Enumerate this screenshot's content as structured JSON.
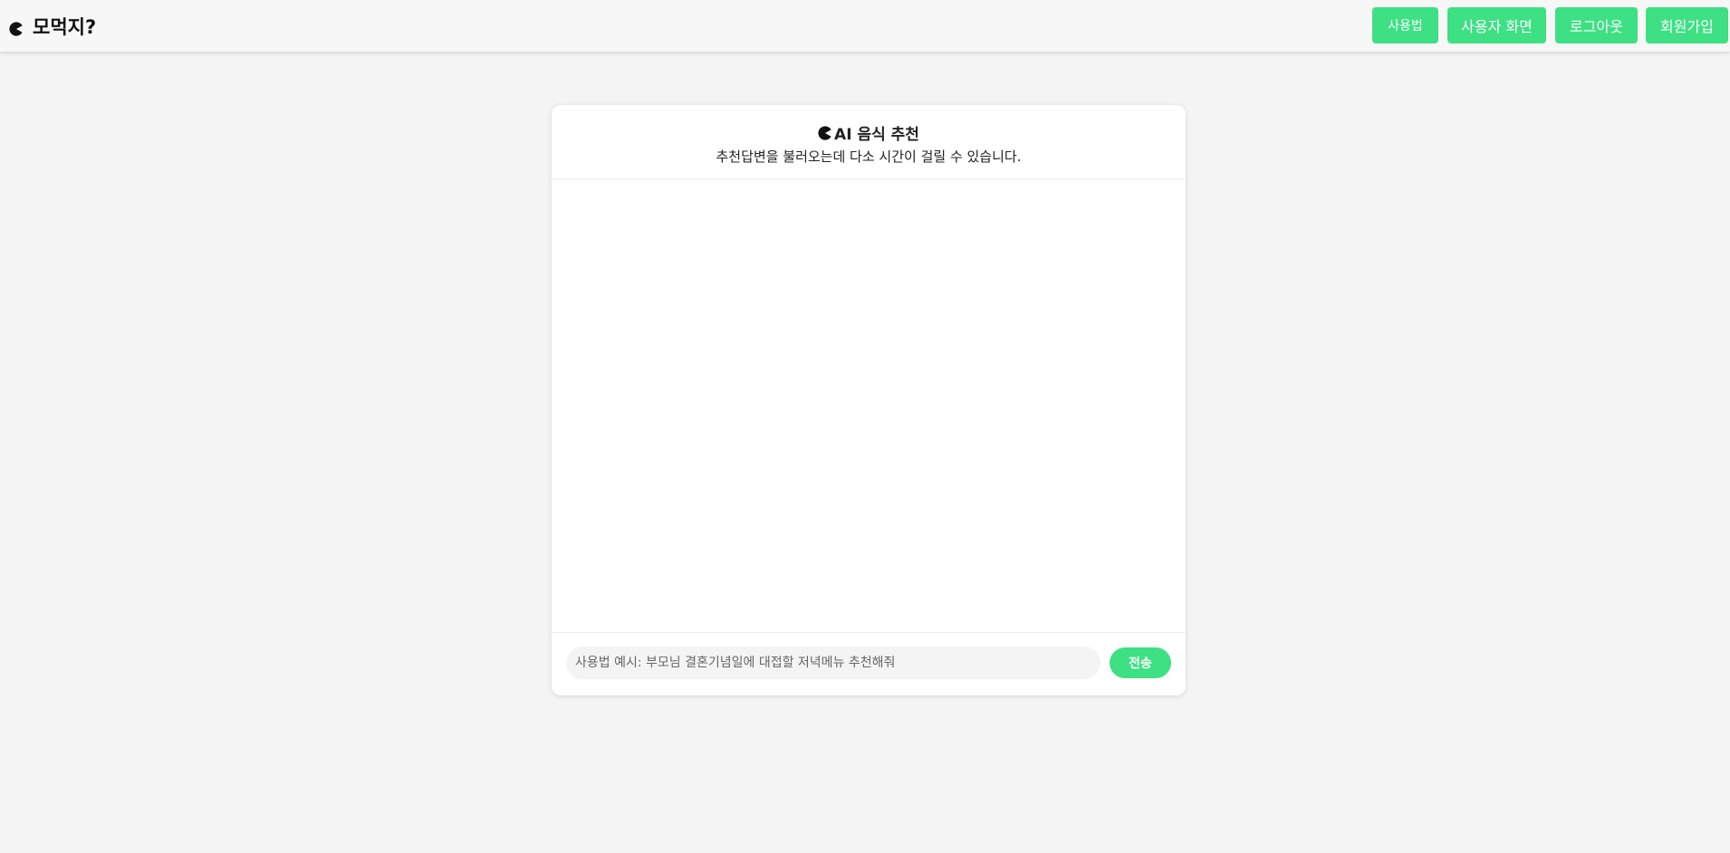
{
  "brand": {
    "icon": "pacman-icon",
    "title": "모먹지?"
  },
  "nav": {
    "items": [
      {
        "label": "사용법",
        "icon": null
      },
      {
        "label": "사용자 화면",
        "icon": null
      },
      {
        "label": "로그아웃",
        "icon": null
      },
      {
        "label": "회원가입",
        "icon": null
      }
    ]
  },
  "chat": {
    "title_icon": "pacman-icon",
    "title": "AI 음식 추천",
    "subtitle": "추천답변을 불러오는데 다소 시간이 걸릴 수 있습니다.",
    "input_placeholder": "사용법 예시: 부모님 결혼기념일에 대접할 저녁메뉴 추천해줘",
    "input_value": "",
    "send_label": "전송"
  },
  "colors": {
    "accent": "#3ee084",
    "page_bg": "#f4f4f4",
    "topbar_bg": "#f7f7f7",
    "card_bg": "#ffffff"
  }
}
